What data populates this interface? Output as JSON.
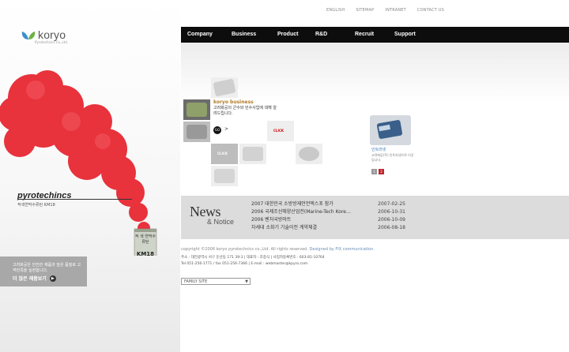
{
  "brand": {
    "name": "koryo",
    "sub": "Pyrotechnics Co.,Ltd."
  },
  "top_links": [
    "ENGLISH",
    "SITEMAP",
    "INTRANET",
    "CONTACT US"
  ],
  "nav": [
    "Company",
    "Business",
    "Product",
    "R&D",
    "Recruit",
    "Support"
  ],
  "product": {
    "name": "pyrotechincs",
    "subtitle": "적색연막수류탄 KM18",
    "can_label": "적 색\n연막수류탄",
    "can_model": "KM18"
  },
  "promo": {
    "text": "고려화공은 안전한 제품과 높은 품질로 고객만족을 실현합니다.",
    "link": "더 많은 제품보기"
  },
  "business": {
    "title": "koryo business",
    "desc": "고려화공의 군수와 민수사업에 대해 알려드립니다.",
    "go": "GO",
    "arrow": ">",
    "click": "CLICK"
  },
  "feature": {
    "title": "인트라넷",
    "desc": "고려화공(주) 인트라넷으로 이곳입니다."
  },
  "pager": [
    "1",
    "2"
  ],
  "news": {
    "title": "News",
    "subtitle": "& Notice",
    "items": [
      {
        "title": "2007 대한민국 소방방재안전엑스포 참가",
        "date": "2007-02-25"
      },
      {
        "title": "2006 국제조선해양산업전(Marine-Tech Kore…",
        "date": "2006-10-31"
      },
      {
        "title": "2006 벤처국방마트",
        "date": "2006-10-09"
      },
      {
        "title": "차세대 소화기 기술이전 계약체결",
        "date": "2006-08-18"
      }
    ]
  },
  "footer": {
    "copyright": "copyright ©2006 koryo pyrotechnics co.,Ltd. All rights reserved.",
    "designed": "Designed by FIX communication.",
    "address_line1": "주소 : 대전광역시 서구 둔산동 171 39-3  |  대표자 : 조중식  |  사업자등록번호 : 603-81-10764",
    "address_line2": "Tel 051-256-1771 / fax 051-256-7366  |  E-mail : webmaster@kpyro.com",
    "family_site": "FAMILY SITE"
  },
  "colors": {
    "nav_bg": "#0d0d0d",
    "smoke": "#e8323c",
    "accent_gold": "#b07a28",
    "pager_active": "#c0272d",
    "pager_inactive": "#999999"
  }
}
